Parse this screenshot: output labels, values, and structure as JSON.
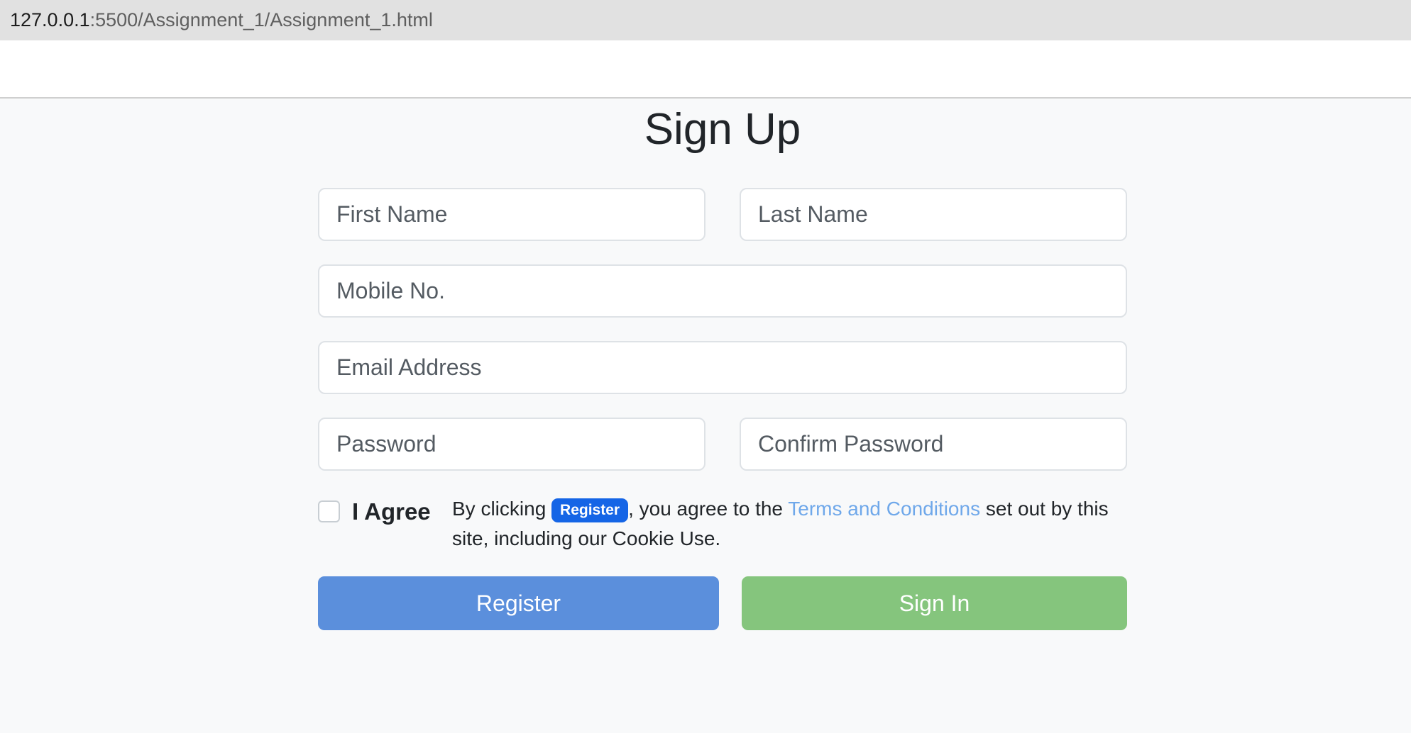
{
  "browser": {
    "url_host": "127.0.0.1",
    "url_rest": ":5500/Assignment_1/Assignment_1.html"
  },
  "page": {
    "title": "Sign Up"
  },
  "form": {
    "first_name_placeholder": "First Name",
    "last_name_placeholder": "Last Name",
    "mobile_placeholder": "Mobile No.",
    "email_placeholder": "Email Address",
    "password_placeholder": "Password",
    "confirm_password_placeholder": "Confirm Password",
    "agree_label": "I Agree",
    "agree_checked": false,
    "terms": {
      "prefix": "By clicking ",
      "badge": "Register",
      "middle": ", you agree to the ",
      "link": "Terms and Conditions",
      "suffix": " set out by this site, including our Cookie Use."
    },
    "register_label": "Register",
    "signin_label": "Sign In"
  },
  "colors": {
    "register_button": "#5b8fdc",
    "signin_button": "#85c57d",
    "badge": "#1565e6",
    "link": "#6fa8ea"
  }
}
